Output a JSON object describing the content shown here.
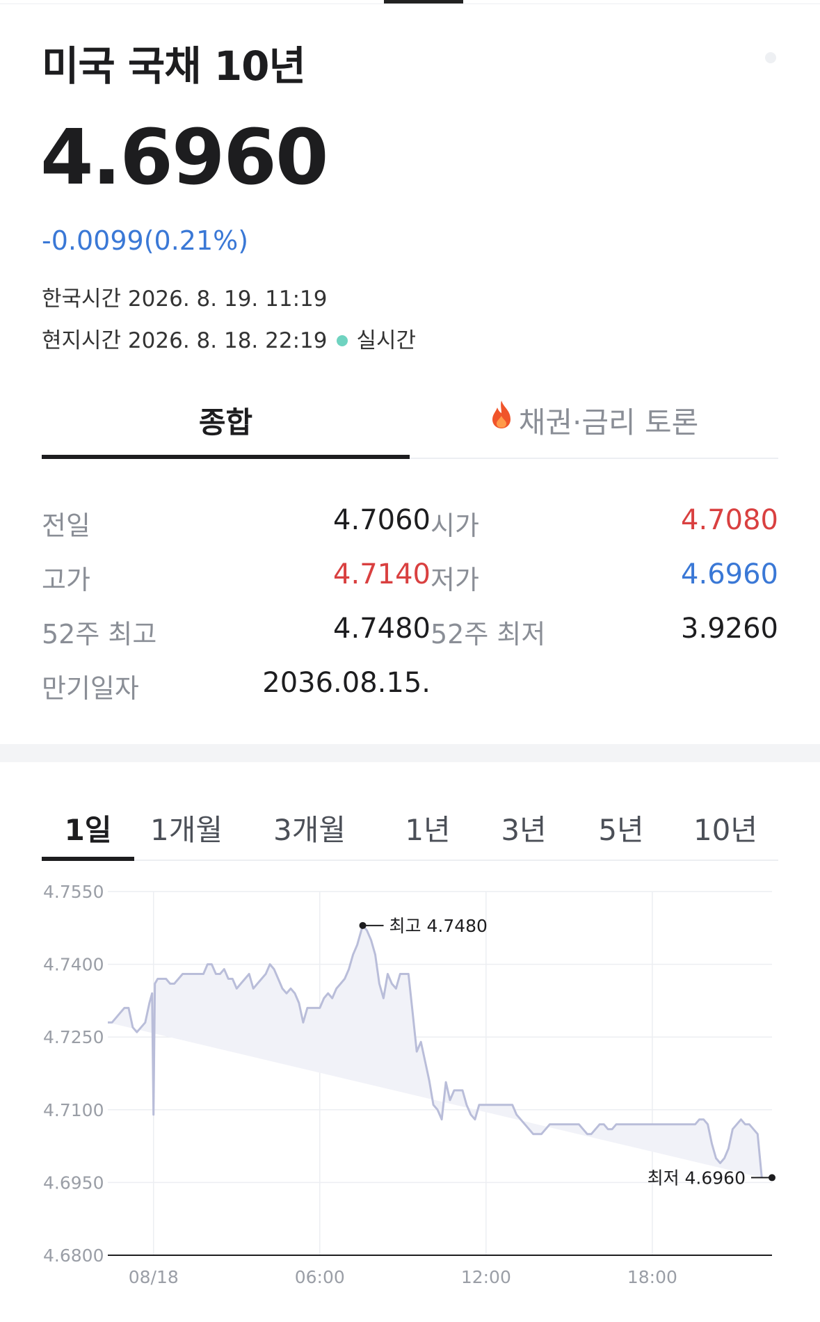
{
  "header": {
    "title": "미국 국채 10년",
    "price": "4.6960",
    "change": "-0.0099",
    "change_pct": "(0.21%)",
    "time_kr": "한국시간 2026. 8. 19. 11:19",
    "time_local": "현지시간 2026. 8. 18. 22:19",
    "live_label": "실시간"
  },
  "tabs": [
    {
      "label": "종합",
      "active": true
    },
    {
      "label": "채권·금리 토론",
      "active": false,
      "icon": "fire-icon"
    }
  ],
  "stats": {
    "prev_label": "전일",
    "prev_value": "4.7060",
    "open_label": "시가",
    "open_value": "4.7080",
    "high_label": "고가",
    "high_value": "4.7140",
    "low_label": "저가",
    "low_value": "4.6960",
    "high52_label": "52주 최고",
    "high52_value": "4.7480",
    "low52_label": "52주 최저",
    "low52_value": "3.9260",
    "maturity_label": "만기일자",
    "maturity_value": "2036.08.15."
  },
  "periods": [
    {
      "label": "1일",
      "active": true
    },
    {
      "label": "1개월",
      "active": false
    },
    {
      "label": "3개월",
      "active": false
    },
    {
      "label": "1년",
      "active": false
    },
    {
      "label": "3년",
      "active": false
    },
    {
      "label": "5년",
      "active": false
    },
    {
      "label": "10년",
      "active": false
    }
  ],
  "colors": {
    "up": "#d94040",
    "down": "#3a78d6",
    "line": "#b9bdd9",
    "area": "#f1f2f8",
    "live": "#6fd3c0"
  },
  "chart_data": {
    "type": "line",
    "y_ticks": [
      "4.7550",
      "4.7400",
      "4.7250",
      "4.7100",
      "4.6950",
      "4.6800"
    ],
    "ylim": [
      4.68,
      4.755
    ],
    "x_ticks": [
      "08/18",
      "06:00",
      "12:00",
      "18:00"
    ],
    "x_tick_hours": [
      0,
      6,
      12,
      18
    ],
    "xlim_hours": [
      -1.65,
      22.32
    ],
    "max_annotation": {
      "label": "최고 4.7480",
      "x_hours": 7.55,
      "y": 4.748
    },
    "min_annotation": {
      "label": "최저 4.6960",
      "x_hours": 22.32,
      "y": 4.696
    },
    "x_hours": [
      -1.65,
      -1.5,
      -1.35,
      -1.2,
      -1.05,
      -0.9,
      -0.75,
      -0.6,
      -0.45,
      -0.3,
      -0.15,
      -0.05,
      0.0,
      0.05,
      0.15,
      0.3,
      0.45,
      0.6,
      0.75,
      0.9,
      1.05,
      1.2,
      1.35,
      1.5,
      1.65,
      1.8,
      1.95,
      2.1,
      2.25,
      2.4,
      2.55,
      2.7,
      2.85,
      3.0,
      3.15,
      3.3,
      3.45,
      3.6,
      3.75,
      3.9,
      4.05,
      4.2,
      4.35,
      4.5,
      4.65,
      4.8,
      4.95,
      5.1,
      5.25,
      5.4,
      5.55,
      5.7,
      5.85,
      6.0,
      6.15,
      6.3,
      6.45,
      6.6,
      6.75,
      6.9,
      7.05,
      7.2,
      7.35,
      7.55,
      7.7,
      7.85,
      8.0,
      8.15,
      8.3,
      8.45,
      8.6,
      8.75,
      8.9,
      9.05,
      9.2,
      9.35,
      9.5,
      9.65,
      9.8,
      9.95,
      10.1,
      10.25,
      10.4,
      10.55,
      10.7,
      10.85,
      11.0,
      11.15,
      11.3,
      11.45,
      11.6,
      11.75,
      11.9,
      12.05,
      12.2,
      12.35,
      12.5,
      12.65,
      12.8,
      12.95,
      13.1,
      13.25,
      13.4,
      13.55,
      13.7,
      13.85,
      14.0,
      14.15,
      14.3,
      14.45,
      14.6,
      14.75,
      14.9,
      15.05,
      15.2,
      15.35,
      15.5,
      15.65,
      15.8,
      15.95,
      16.1,
      16.25,
      16.4,
      16.55,
      16.7,
      16.85,
      17.0,
      17.15,
      17.3,
      17.45,
      17.6,
      17.75,
      17.9,
      18.05,
      18.2,
      18.35,
      18.5,
      18.65,
      18.8,
      18.95,
      19.1,
      19.25,
      19.4,
      19.55,
      19.7,
      19.85,
      20.0,
      20.15,
      20.3,
      20.45,
      20.6,
      20.75,
      20.9,
      21.05,
      21.2,
      21.35,
      21.5,
      21.65,
      21.8,
      21.95,
      22.1,
      22.2,
      22.32
    ],
    "values": [
      4.728,
      4.728,
      4.729,
      4.73,
      4.731,
      4.731,
      4.727,
      4.726,
      4.727,
      4.728,
      4.732,
      4.734,
      4.709,
      4.736,
      4.737,
      4.737,
      4.737,
      4.736,
      4.736,
      4.737,
      4.738,
      4.738,
      4.738,
      4.738,
      4.738,
      4.738,
      4.74,
      4.74,
      4.738,
      4.738,
      4.739,
      4.737,
      4.737,
      4.735,
      4.736,
      4.737,
      4.738,
      4.735,
      4.736,
      4.737,
      4.738,
      4.74,
      4.739,
      4.737,
      4.735,
      4.734,
      4.735,
      4.734,
      4.732,
      4.728,
      4.731,
      4.731,
      4.731,
      4.731,
      4.733,
      4.734,
      4.733,
      4.735,
      4.736,
      4.737,
      4.739,
      4.742,
      4.744,
      4.748,
      4.747,
      4.745,
      4.742,
      4.736,
      4.733,
      4.738,
      4.736,
      4.735,
      4.738,
      4.738,
      4.738,
      4.73,
      4.722,
      4.724,
      4.72,
      4.716,
      4.711,
      4.71,
      4.708,
      4.7157,
      4.712,
      4.714,
      4.714,
      4.714,
      4.711,
      4.709,
      4.708,
      4.711,
      4.711,
      4.711,
      4.711,
      4.711,
      4.711,
      4.711,
      4.711,
      4.711,
      4.709,
      4.708,
      4.707,
      4.706,
      4.705,
      4.705,
      4.705,
      4.706,
      4.707,
      4.707,
      4.707,
      4.707,
      4.707,
      4.707,
      4.707,
      4.707,
      4.706,
      4.705,
      4.705,
      4.706,
      4.707,
      4.707,
      4.706,
      4.706,
      4.707,
      4.707,
      4.707,
      4.707,
      4.707,
      4.707,
      4.707,
      4.707,
      4.707,
      4.707,
      4.707,
      4.707,
      4.707,
      4.707,
      4.707,
      4.707,
      4.707,
      4.707,
      4.707,
      4.707,
      4.708,
      4.708,
      4.707,
      4.703,
      4.7,
      4.699,
      4.7,
      4.702,
      4.706,
      4.707,
      4.708,
      4.707,
      4.707,
      4.706,
      4.705,
      4.696
    ]
  }
}
